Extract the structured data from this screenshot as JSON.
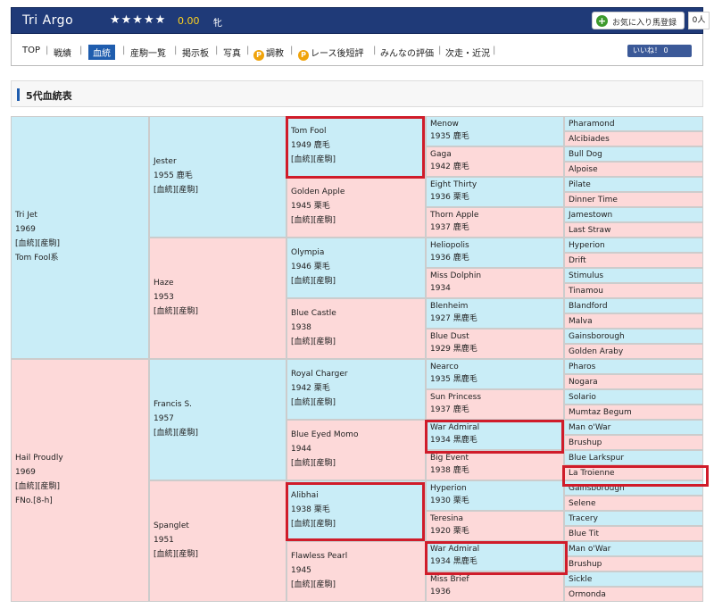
{
  "header": {
    "horse_name": "Tri Argo",
    "stars": "★★★★★",
    "rating": "0.00",
    "sex": "牝",
    "favorite_label": "お気に入り馬登録",
    "favorite_count": "0人"
  },
  "nav": {
    "items": [
      "TOP",
      "戦績",
      "血統",
      "産駒一覧",
      "掲示板",
      "写真",
      "調教",
      "レース後短評",
      "みんなの評価",
      "次走・近況"
    ],
    "active": "血統",
    "like_label": "いいね！ 0"
  },
  "section_title": "5代血統表",
  "link_label": "[血統][産駒]",
  "gen1": [
    {
      "name": "Tri Jet",
      "lines": [
        "1969",
        "[血統][産駒]",
        "Tom Fool系"
      ]
    },
    {
      "name": "Hail Proudly",
      "lines": [
        "1969",
        "[血統][産駒]",
        "FNo.[8-h]"
      ]
    }
  ],
  "gen2": [
    {
      "name": "Jester",
      "lines": [
        "1955 鹿毛",
        "[血統][産駒]"
      ]
    },
    {
      "name": "Haze",
      "lines": [
        "1953",
        "[血統][産駒]"
      ]
    },
    {
      "name": "Francis S.",
      "lines": [
        "1957",
        "[血統][産駒]"
      ]
    },
    {
      "name": "Spanglet",
      "lines": [
        "1951",
        "[血統][産駒]"
      ]
    }
  ],
  "gen3": [
    {
      "name": "Tom Fool",
      "lines": [
        "1949 鹿毛",
        "[血統][産駒]"
      ]
    },
    {
      "name": "Golden Apple",
      "lines": [
        "1945 栗毛",
        "[血統][産駒]"
      ]
    },
    {
      "name": "Olympia",
      "lines": [
        "1946 栗毛",
        "[血統][産駒]"
      ]
    },
    {
      "name": "Blue Castle",
      "lines": [
        "1938",
        "[血統][産駒]"
      ]
    },
    {
      "name": "Royal Charger",
      "lines": [
        "1942 栗毛",
        "[血統][産駒]"
      ]
    },
    {
      "name": "Blue Eyed Momo",
      "lines": [
        "1944",
        "[血統][産駒]"
      ]
    },
    {
      "name": "Alibhai",
      "lines": [
        "1938 栗毛",
        "[血統][産駒]"
      ]
    },
    {
      "name": "Flawless Pearl",
      "lines": [
        "1945",
        "[血統][産駒]"
      ]
    }
  ],
  "gen4": [
    {
      "name": "Menow",
      "line": "1935 鹿毛"
    },
    {
      "name": "Gaga",
      "line": "1942 鹿毛"
    },
    {
      "name": "Eight Thirty",
      "line": "1936 栗毛"
    },
    {
      "name": "Thorn Apple",
      "line": "1937 鹿毛"
    },
    {
      "name": "Heliopolis",
      "line": "1936 鹿毛"
    },
    {
      "name": "Miss Dolphin",
      "line": "1934"
    },
    {
      "name": "Blenheim",
      "line": "1927 黒鹿毛"
    },
    {
      "name": "Blue Dust",
      "line": "1929 黒鹿毛"
    },
    {
      "name": "Nearco",
      "line": "1935 黒鹿毛"
    },
    {
      "name": "Sun Princess",
      "line": "1937 鹿毛"
    },
    {
      "name": "War Admiral",
      "line": "1934 黒鹿毛"
    },
    {
      "name": "Big Event",
      "line": "1938 鹿毛"
    },
    {
      "name": "Hyperion",
      "line": "1930 栗毛"
    },
    {
      "name": "Teresina",
      "line": "1920 栗毛"
    },
    {
      "name": "War Admiral",
      "line": "1934 黒鹿毛"
    },
    {
      "name": "Miss Brief",
      "line": "1936"
    }
  ],
  "gen5": [
    "Pharamond",
    "Alcibiades",
    "Bull Dog",
    "Alpoise",
    "Pilate",
    "Dinner Time",
    "Jamestown",
    "Last Straw",
    "Hyperion",
    "Drift",
    "Stimulus",
    "Tinamou",
    "Blandford",
    "Malva",
    "Gainsborough",
    "Golden Araby",
    "Pharos",
    "Nogara",
    "Solario",
    "Mumtaz Begum",
    "Man o'War",
    "Brushup",
    "Blue Larkspur",
    "La Troienne",
    "Gainsborough",
    "Selene",
    "Tracery",
    "Blue Tit",
    "Man o'War",
    "Brushup",
    "Sickle",
    "Ormonda"
  ],
  "colors": {
    "sire_bg": "#c9edf7",
    "dam_bg": "#fdd9d9",
    "header_bg": "#1f3a78",
    "inbreed_text": "#c8102e",
    "highlight": "#d01c2a"
  }
}
